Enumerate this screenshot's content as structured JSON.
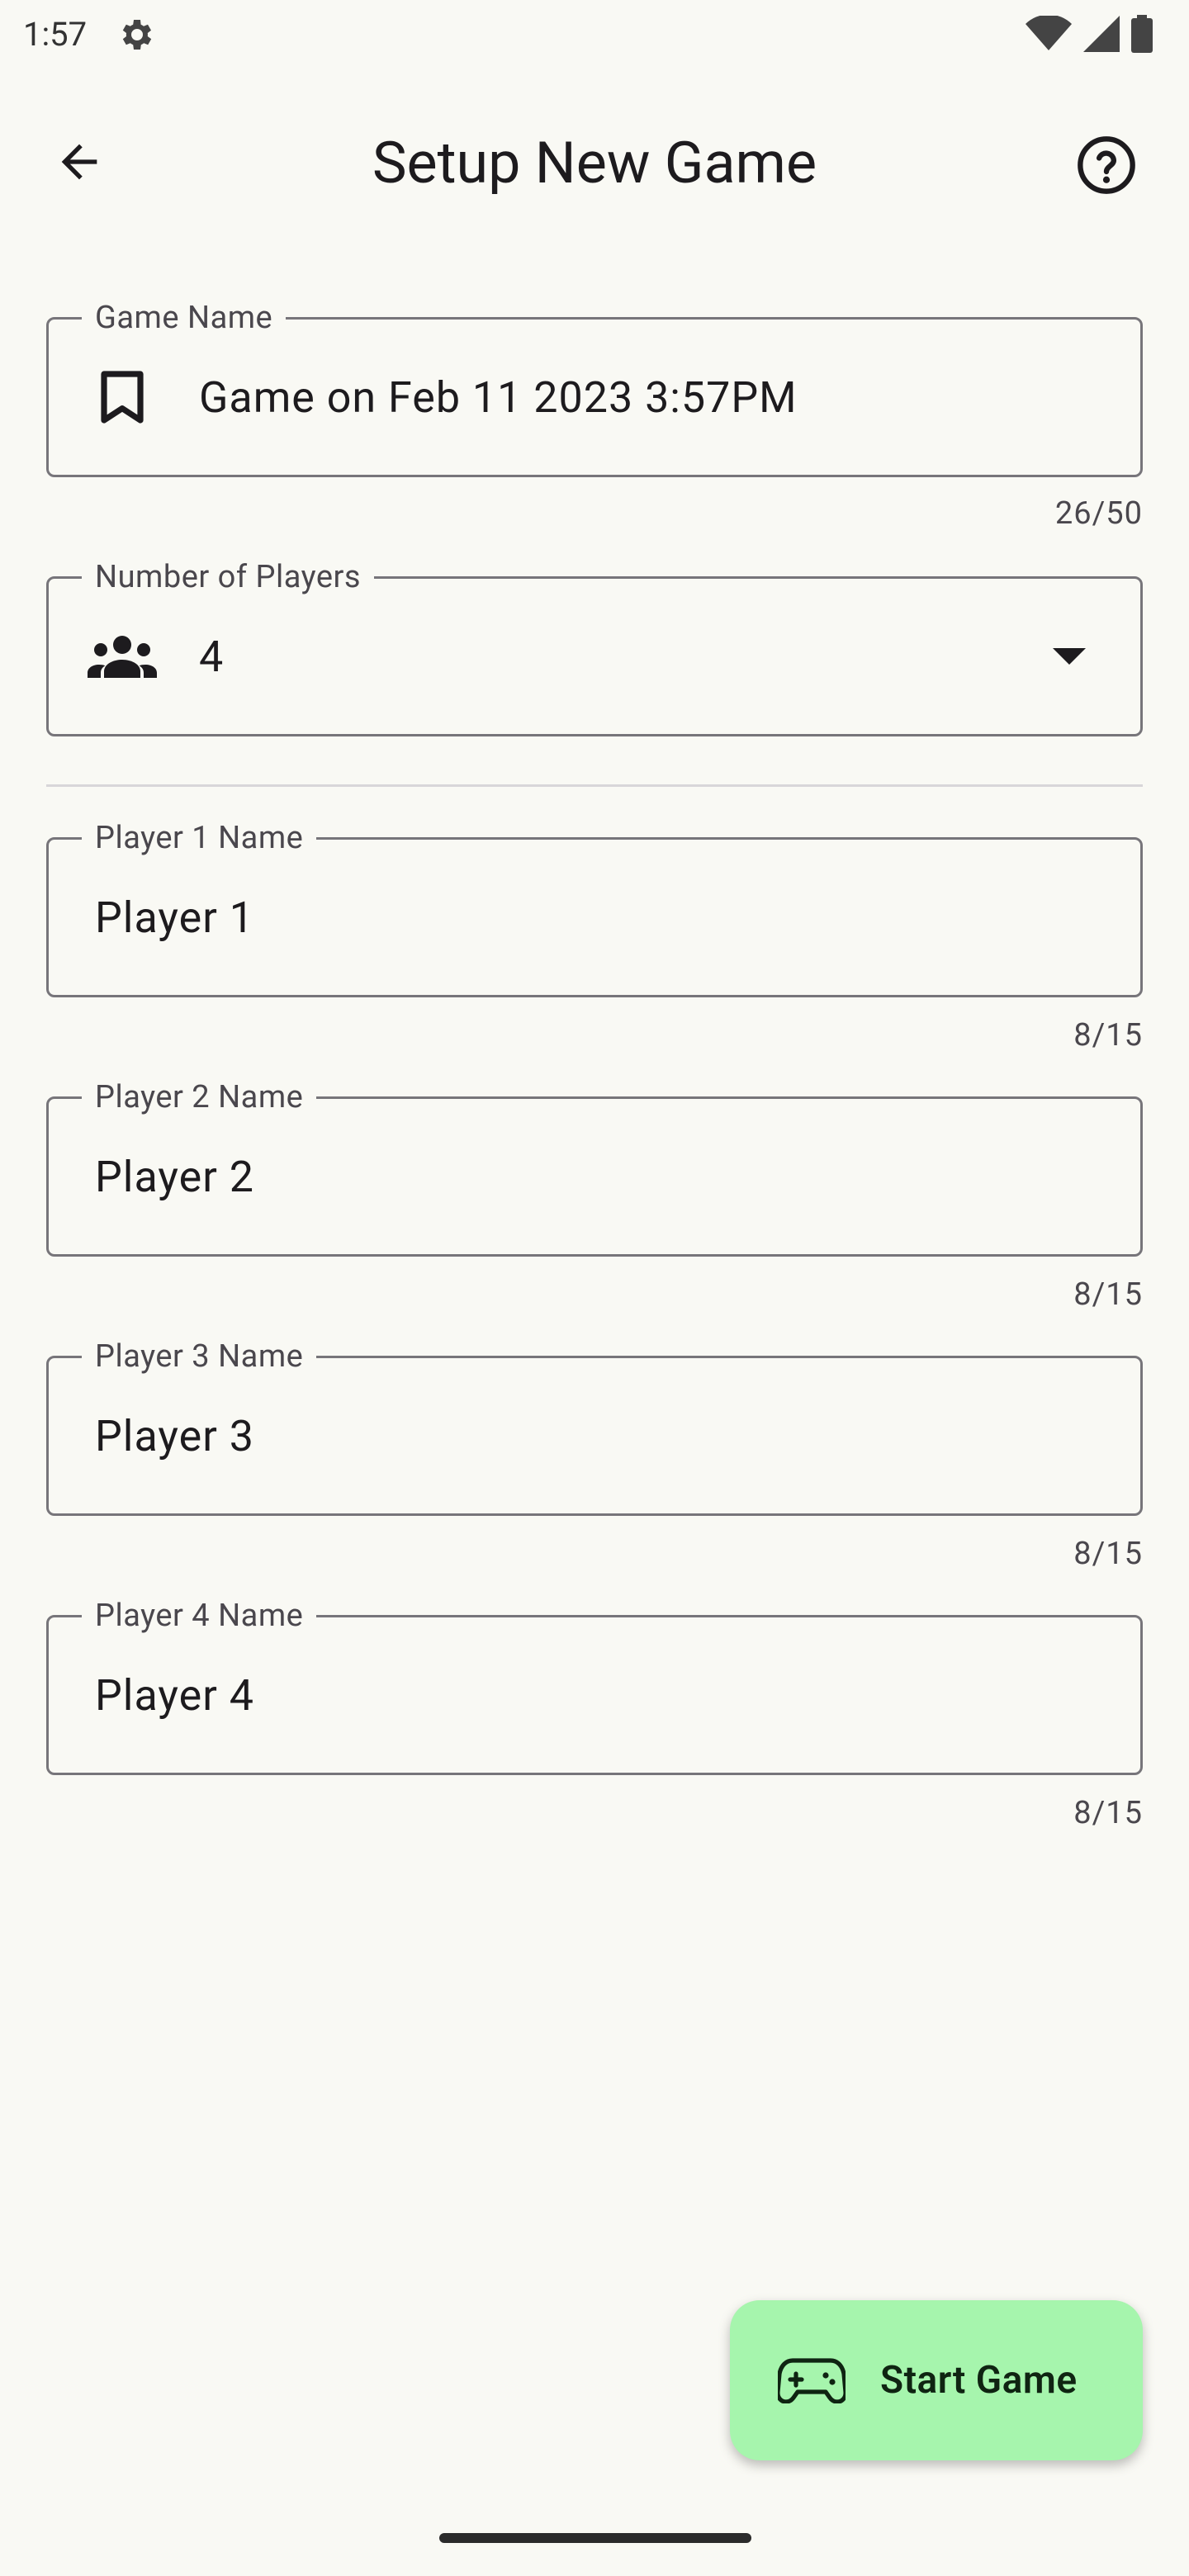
{
  "status_bar": {
    "time": "1:57"
  },
  "app_bar": {
    "title": "Setup New Game",
    "back_icon": "arrow-back-icon",
    "help_icon": "help-circle-icon"
  },
  "game_name": {
    "label": "Game Name",
    "value": "Game on Feb 11 2023 3:57PM",
    "counter": "26/50",
    "icon": "bookmark-icon"
  },
  "num_players": {
    "label": "Number of Players",
    "value": "4",
    "icon": "groups-icon"
  },
  "players": [
    {
      "label": "Player 1 Name",
      "value": "Player 1",
      "counter": "8/15"
    },
    {
      "label": "Player 2 Name",
      "value": "Player 2",
      "counter": "8/15"
    },
    {
      "label": "Player 3 Name",
      "value": "Player 3",
      "counter": "8/15"
    },
    {
      "label": "Player 4 Name",
      "value": "Player 4",
      "counter": "8/15"
    }
  ],
  "fab": {
    "label": "Start Game",
    "icon": "gamepad-icon"
  },
  "colors": {
    "background": "#f9f9f4",
    "fab_background": "#a6f5ad",
    "outline": "#77757a"
  }
}
